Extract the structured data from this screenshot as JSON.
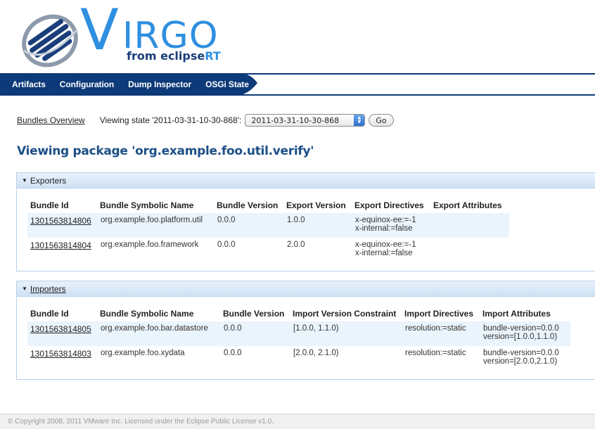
{
  "brand": {
    "word": "VIRGO",
    "from": "from eclipse",
    "rt": "RT"
  },
  "nav": [
    "Artifacts",
    "Configuration",
    "Dump Inspector",
    "OSGi State"
  ],
  "controls": {
    "overview_link": "Bundles Overview",
    "viewing_label": "Viewing state '2011-03-31-10-30-868':",
    "selected_state": "2011-03-31-10-30-868",
    "go_label": "Go"
  },
  "page_title": "Viewing package 'org.example.foo.util.verify'",
  "exporters": {
    "title": "Exporters",
    "columns": [
      "Bundle Id",
      "Bundle Symbolic Name",
      "Bundle Version",
      "Export Version",
      "Export Directives",
      "Export Attributes"
    ],
    "rows": [
      {
        "id": "1301563814806",
        "name": "org.example.foo.platform.util",
        "bundle_version": "0.0.0",
        "version": "1.0.0",
        "directives": [
          "x-equinox-ee:=-1",
          "x-internal:=false"
        ],
        "attributes": []
      },
      {
        "id": "1301563814804",
        "name": "org.example.foo.framework",
        "bundle_version": "0.0.0",
        "version": "2.0.0",
        "directives": [
          "x-equinox-ee:=-1",
          "x-internal:=false"
        ],
        "attributes": []
      }
    ]
  },
  "importers": {
    "title": "Importers",
    "columns": [
      "Bundle Id",
      "Bundle Symbolic Name",
      "Bundle Version",
      "Import Version Constraint",
      "Import Directives",
      "Import Attributes"
    ],
    "rows": [
      {
        "id": "1301563814805",
        "name": "org.example.foo.bar.datastore",
        "bundle_version": "0.0.0",
        "version": "[1.0.0, 1.1.0)",
        "directives": [
          "resolution:=static"
        ],
        "attributes": [
          "bundle-version=0.0.0",
          "version=[1.0.0,1.1.0)"
        ]
      },
      {
        "id": "1301563814803",
        "name": "org.example.foo.xydata",
        "bundle_version": "0.0.0",
        "version": "[2.0.0, 2.1.0)",
        "directives": [
          "resolution:=static"
        ],
        "attributes": [
          "bundle-version=0.0.0",
          "version=[2.0.0,2.1.0)"
        ]
      }
    ]
  },
  "footer": "© Copyright 2008, 2011 VMware Inc. Licensed under the Eclipse Public License v1.0.",
  "colors": {
    "nav_bg": "#0d3a78",
    "title": "#1c4f86",
    "panel_header": "#d9e8f7",
    "row_alt": "#eaf4fc",
    "logo_blue": "#2f8fe0"
  }
}
